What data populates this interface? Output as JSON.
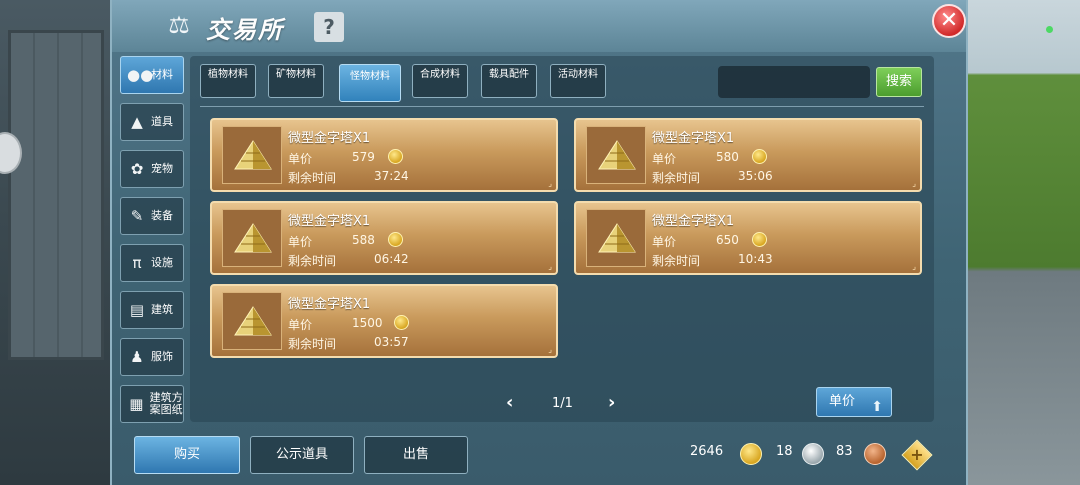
{
  "window": {
    "title": "交易所",
    "help_label": "?",
    "close_label": "✕"
  },
  "categories": [
    {
      "label": "材料",
      "icon": "materials-icon",
      "glyph": "●●",
      "active": true
    },
    {
      "label": "道具",
      "icon": "item-icon",
      "glyph": "▲",
      "active": false
    },
    {
      "label": "宠物",
      "icon": "paw-icon",
      "glyph": "✿",
      "active": false
    },
    {
      "label": "装备",
      "icon": "equipment-icon",
      "glyph": "✎",
      "active": false
    },
    {
      "label": "设施",
      "icon": "facility-icon",
      "glyph": "π",
      "active": false
    },
    {
      "label": "建筑",
      "icon": "building-icon",
      "glyph": "▤",
      "active": false
    },
    {
      "label": "服饰",
      "icon": "clothing-icon",
      "glyph": "♟",
      "active": false
    },
    {
      "label": "建筑方案图纸",
      "icon": "blueprint-icon",
      "glyph": "▦",
      "active": false
    }
  ],
  "sub_tabs": [
    {
      "label": "植物材料",
      "active": false
    },
    {
      "label": "矿物材料",
      "active": false
    },
    {
      "label": "怪物材料",
      "active": true
    },
    {
      "label": "合成材料",
      "active": false
    },
    {
      "label": "载具配件",
      "active": false
    },
    {
      "label": "活动材料",
      "active": false
    }
  ],
  "search": {
    "placeholder": "",
    "button_label": "搜索"
  },
  "listings": [
    {
      "name": "微型金字塔X1",
      "price_label": "单价",
      "price": "579",
      "time_label": "剩余时间",
      "time": "37:24"
    },
    {
      "name": "微型金字塔X1",
      "price_label": "单价",
      "price": "580",
      "time_label": "剩余时间",
      "time": "35:06"
    },
    {
      "name": "微型金字塔X1",
      "price_label": "单价",
      "price": "588",
      "time_label": "剩余时间",
      "time": "06:42"
    },
    {
      "name": "微型金字塔X1",
      "price_label": "单价",
      "price": "650",
      "time_label": "剩余时间",
      "time": "10:43"
    },
    {
      "name": "微型金字塔X1",
      "price_label": "单价",
      "price": "1500",
      "time_label": "剩余时间",
      "time": "03:57"
    }
  ],
  "pager": {
    "text": "1/1",
    "prev_glyph": "‹",
    "next_glyph": "›"
  },
  "sort": {
    "label": "单价",
    "icon": "sort-arrow-icon"
  },
  "actions": {
    "buy": "购买",
    "public_items": "公示道具",
    "sell": "出售"
  },
  "currency": {
    "gold": "2646",
    "silver": "18",
    "copper": "83",
    "add_label": "+"
  },
  "colors": {
    "accent_blue": "#2f77b0",
    "listing_gold": "#c99a5c",
    "search_green": "#4b9d2e",
    "close_red": "#d12a2a"
  }
}
